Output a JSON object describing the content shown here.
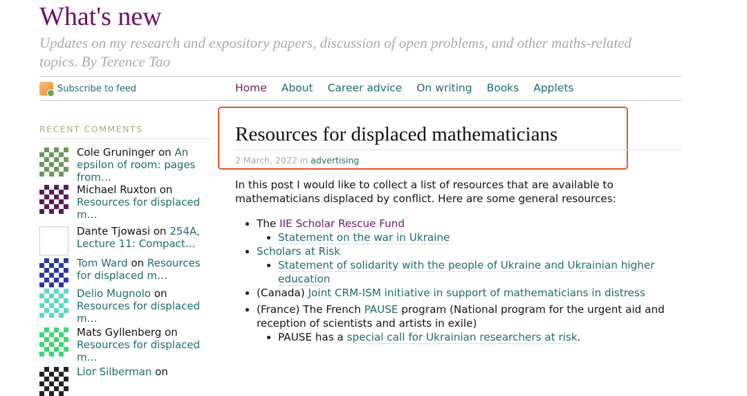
{
  "site": {
    "title": "What's new",
    "tagline": "Updates on my research and expository papers, discussion of open problems, and other maths-related topics. By Terence Tao",
    "subscribe": "Subscribe to feed"
  },
  "nav": [
    "Home",
    "About",
    "Career advice",
    "On writing",
    "Books",
    "Applets"
  ],
  "sidebar": {
    "heading": "RECENT COMMENTS",
    "comments": [
      {
        "author": "Cole Gruninger",
        "on": "on",
        "post": "An epsilon of room: pages from…",
        "author_link": false,
        "avatar_color": "#6a9a5a"
      },
      {
        "author": "Michael Ruxton",
        "on": "on",
        "post": "Resources for displaced m…",
        "author_link": false,
        "avatar_color": "#5a1a5a"
      },
      {
        "author": "Dante Tjowasi",
        "on": "on",
        "post": "254A, Lecture 11: Compact…",
        "author_link": false,
        "avatar_color": "#ffffff"
      },
      {
        "author": "Tom Ward",
        "on": "on",
        "post": "Resources for displaced m…",
        "author_link": true,
        "avatar_color": "#2a3aa0"
      },
      {
        "author": "Delio Mugnolo",
        "on": "on",
        "post": "Resources for displaced m…",
        "author_link": true,
        "avatar_color": "#5ad8c8"
      },
      {
        "author": "Mats Gyllenberg",
        "on": "on",
        "post": "Resources for displaced m…",
        "author_link": false,
        "avatar_color": "#3ad870"
      },
      {
        "author": "Lior Silberman",
        "on": "on",
        "post": "",
        "author_link": true,
        "avatar_color": "#222222"
      }
    ]
  },
  "post": {
    "title": "Resources for displaced mathematicians",
    "date": "2 March, 2022",
    "in": "in",
    "category": "advertising",
    "intro": "In this post I would like to collect a list of resources that are available to mathematicians displaced by conflict. Here are some general resources:",
    "items": [
      {
        "pre": "The ",
        "link": "IIE Scholar Rescue Fund",
        "post": "",
        "sub": [
          {
            "pre": "",
            "link": "Statement on the war in Ukraine",
            "post": ""
          }
        ]
      },
      {
        "pre": "",
        "link": "Scholars at Risk",
        "post": "",
        "sub": [
          {
            "pre": "",
            "link": "Statement of solidarity with the people of Ukraine and Ukrainian higher education",
            "post": ""
          }
        ]
      },
      {
        "pre": "(Canada) ",
        "link": "Joint CRM-ISM initiative in support of mathematicians in distress",
        "post": ""
      },
      {
        "pre": "(France) The French ",
        "link": "PAUSE",
        "post": " program (National program for the urgent aid and reception of scientists and artists in exile)",
        "sub": [
          {
            "pre": "PAUSE has a ",
            "link": "special call for Ukrainian researchers at risk",
            "post": "."
          }
        ]
      }
    ]
  },
  "colors": {
    "title": "#6b0f6b",
    "link": "#1d6b6b",
    "visited": "#6b1a6b",
    "highlight": "#f0502a"
  }
}
